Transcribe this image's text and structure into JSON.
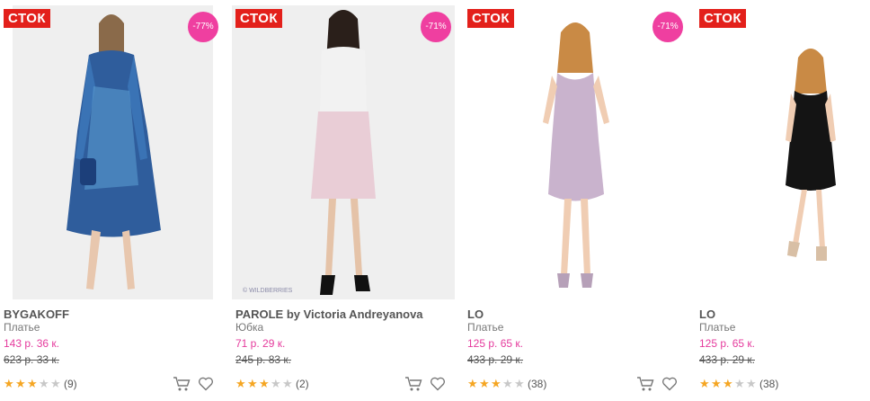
{
  "products": [
    {
      "stock": "СТОК",
      "discount": "-77%",
      "brand": "BYGAKOFF",
      "type": "Платье",
      "price": "143 р. 36 к.",
      "old_price": "623 р. 33 к.",
      "rating": 3,
      "reviews": "(9)",
      "watermark": ""
    },
    {
      "stock": "СТОК",
      "discount": "-71%",
      "brand": "PAROLE by Victoria Andreyanova",
      "type": "Юбка",
      "price": "71 р. 29 к.",
      "old_price": "245 р. 83 к.",
      "rating": 3,
      "reviews": "(2)",
      "watermark": "© WILDBERRIES"
    },
    {
      "stock": "СТОК",
      "discount": "-71%",
      "brand": "LO",
      "type": "Платье",
      "price": "125 р. 65 к.",
      "old_price": "433 р. 29 к.",
      "rating": 3,
      "reviews": "(38)",
      "watermark": ""
    },
    {
      "stock": "СТОК",
      "discount": "",
      "brand": "LO",
      "type": "Платье",
      "price": "125 р. 65 к.",
      "old_price": "433 р. 29 к.",
      "rating": 3,
      "reviews": "(38)",
      "watermark": ""
    }
  ],
  "icons": {
    "cart": "cart-icon",
    "favorite": "heart-icon",
    "star": "star-icon"
  },
  "colors": {
    "stock_badge": "#e3201b",
    "discount_badge": "#ef3fa0",
    "price": "#e53b9d",
    "star": "#f5a623"
  }
}
